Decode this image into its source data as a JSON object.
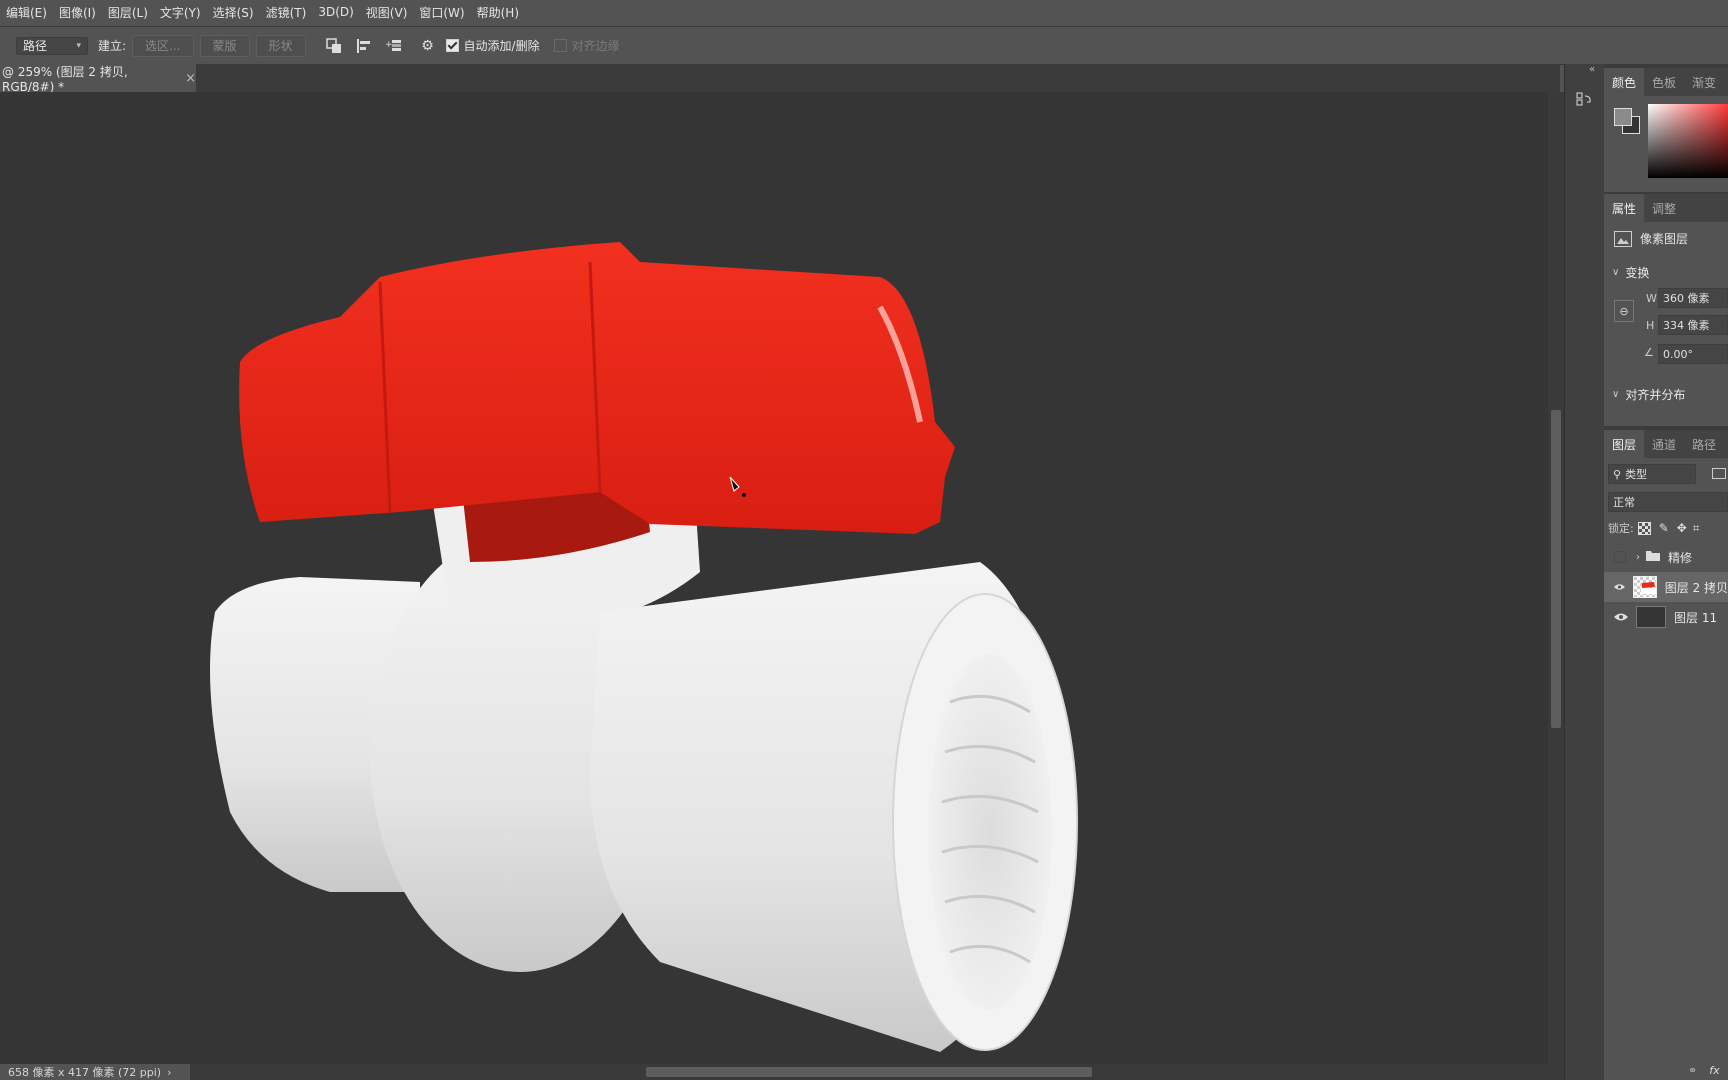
{
  "menubar": {
    "items": [
      "编辑(E)",
      "图像(I)",
      "图层(L)",
      "文字(Y)",
      "选择(S)",
      "滤镜(T)",
      "3D(D)",
      "视图(V)",
      "窗口(W)",
      "帮助(H)"
    ]
  },
  "options": {
    "mode_value": "路径",
    "build_label": "建立:",
    "selection_btn": "选区...",
    "mask_btn": "蒙版",
    "shape_btn": "形状",
    "auto_add_label": "自动添加/删除",
    "auto_add_checked": true,
    "align_edges_label": "对齐边缘",
    "align_edges_checked": false
  },
  "document": {
    "tab_title": "@ 259% (图层 2 拷贝, RGB/8#) *",
    "close_glyph": "×"
  },
  "status": {
    "text": "658 像素 x 417 像素 (72 ppi)"
  },
  "color_panel": {
    "tabs": [
      "颜色",
      "色板",
      "渐变"
    ]
  },
  "properties_panel": {
    "tabs": [
      "属性",
      "调整"
    ],
    "layer_type": "像素图层",
    "transform_title": "变换",
    "w_label": "W",
    "w_value": "360 像素",
    "h_label": "H",
    "h_value": "334 像素",
    "angle_value": "0.00°",
    "align_title": "对齐并分布"
  },
  "layers_panel": {
    "tabs": [
      "图层",
      "通道",
      "路径"
    ],
    "filter_value": "类型",
    "blend_mode": "正常",
    "lock_label": "锁定:",
    "layers": [
      {
        "name": "精修",
        "type": "group"
      },
      {
        "name": "图层 2 拷贝",
        "type": "pixel",
        "selected": true
      },
      {
        "name": "图层 11",
        "type": "pixel"
      }
    ],
    "fx_label": "fx"
  },
  "colors": {
    "ui_bg": "#535353",
    "canvas_bg": "#353535",
    "valve_handle": "#e8291c",
    "valve_body": "#eeeeee"
  }
}
